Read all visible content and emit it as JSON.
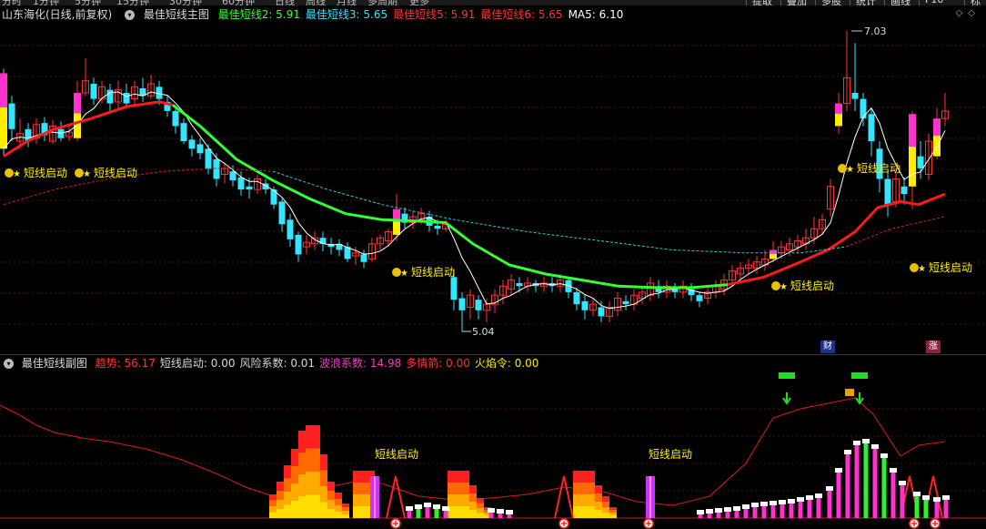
{
  "colors": {
    "up": "#ff3333",
    "down": "#33e5ff",
    "ma5": "#ffffff",
    "line_green": "#33ff33",
    "line_red": "#ff1a1a",
    "magenta": "#ff33cc",
    "yellow": "#ffee00",
    "grid": "#551111"
  },
  "topbar": {
    "items": [
      "分时",
      "1分钟",
      "5分钟",
      "15分钟",
      "30分钟",
      "60分钟",
      "日线",
      "周线",
      "月线",
      "多周期",
      "更多"
    ],
    "right_buttons": [
      "提取",
      "叠加",
      "多股",
      "统计",
      "画线",
      "F10",
      "标记"
    ]
  },
  "main_header": {
    "stock": "山东海化(日线,前复权)",
    "indicator": "最佳短线主图",
    "items": [
      {
        "label": "最佳短线2:",
        "value": "5.91",
        "color": "#33ff33"
      },
      {
        "label": "最佳短线3:",
        "value": "5.65",
        "color": "#33e5ff"
      },
      {
        "label": "最佳短线5:",
        "value": "5.91",
        "color": "#ff3333"
      },
      {
        "label": "最佳短线6:",
        "value": "5.65",
        "color": "#ff3333"
      },
      {
        "label": "MA5:",
        "value": "6.10",
        "color": "#ffffff"
      }
    ]
  },
  "main_chart": {
    "high_label": "7.03",
    "low_label": "5.04",
    "signal_text": "短线启动",
    "badges": [
      {
        "text": "财",
        "color": "#3355ff"
      },
      {
        "text": "涨",
        "color": "#ff3355"
      }
    ]
  },
  "sub_header": {
    "name": "最佳短线副图",
    "items": [
      {
        "label": "趋势:",
        "value": "56.17",
        "color": "#ff3333"
      },
      {
        "label": "短线启动:",
        "value": "0.00",
        "color": "#d8d8d8"
      },
      {
        "label": "风险系数:",
        "value": "0.01",
        "color": "#d8d8d8"
      },
      {
        "label": "波浪系数:",
        "value": "14.98",
        "color": "#ff33cc"
      },
      {
        "label": "多情箭:",
        "value": "0.00",
        "color": "#ff3333"
      },
      {
        "label": "火焰令:",
        "value": "0.00",
        "color": "#ffee00"
      }
    ],
    "signal_text": "短线启动"
  }
}
